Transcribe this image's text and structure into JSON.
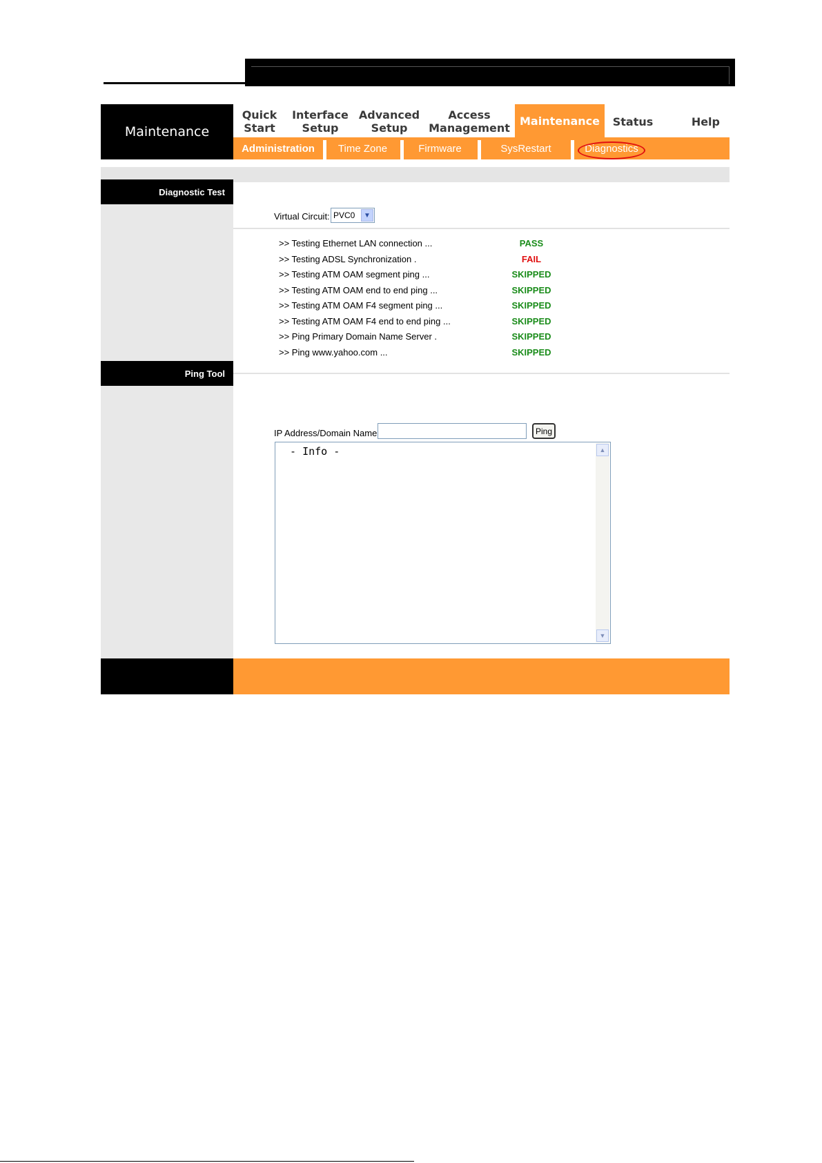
{
  "header": {
    "page_title": "Maintenance"
  },
  "nav": {
    "items": [
      {
        "label": "Quick\nStart"
      },
      {
        "label": "Interface\nSetup"
      },
      {
        "label": "Advanced\nSetup"
      },
      {
        "label": "Access\nManagement"
      },
      {
        "label": "Maintenance",
        "active": true
      },
      {
        "label": "Status"
      },
      {
        "label": "Help"
      }
    ]
  },
  "subnav": {
    "items": [
      {
        "label": "Administration",
        "active": true
      },
      {
        "label": "Time Zone"
      },
      {
        "label": "Firmware"
      },
      {
        "label": "SysRestart"
      },
      {
        "label": "Diagnostics",
        "highlighted": true
      }
    ]
  },
  "diagnostic": {
    "section_label": "Diagnostic Test",
    "vc_label": "Virtual Circuit:",
    "vc_value": "PVC0",
    "tests": [
      {
        "label": ">> Testing Ethernet LAN connection ...",
        "status": "PASS"
      },
      {
        "label": ">> Testing ADSL Synchronization .",
        "status": "FAIL"
      },
      {
        "label": ">> Testing ATM OAM segment ping ...",
        "status": "SKIPPED"
      },
      {
        "label": ">> Testing ATM OAM end to end ping ...",
        "status": "SKIPPED"
      },
      {
        "label": ">> Testing ATM OAM F4 segment ping ...",
        "status": "SKIPPED"
      },
      {
        "label": ">> Testing ATM OAM F4 end to end ping ...",
        "status": "SKIPPED"
      },
      {
        "label": ">> Ping Primary Domain Name Server .",
        "status": "SKIPPED"
      },
      {
        "label": ">> Ping www.yahoo.com ...",
        "status": "SKIPPED"
      }
    ]
  },
  "ping_tool": {
    "section_label": "Ping Tool",
    "ip_label": "IP Address/Domain Name:",
    "ip_value": "",
    "ping_button": "Ping",
    "info_text": " - Info -"
  },
  "colors": {
    "accent": "#ff9933",
    "pass": "#1a8c1a",
    "fail": "#e01010",
    "skipped": "#1a8c1a",
    "highlight_circle": "#e01010"
  }
}
